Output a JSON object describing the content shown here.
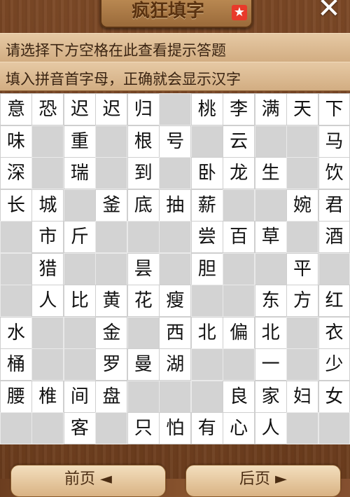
{
  "header": {
    "title": "疯狂填字"
  },
  "hints": {
    "line1": "请选择下方空格在此查看提示答题",
    "line2": "填入拼音首字母，正确就会显示汉字"
  },
  "grid": [
    [
      "意",
      "恐",
      "迟",
      "迟",
      "归",
      "",
      "桃",
      "李",
      "满",
      "天",
      "下"
    ],
    [
      "味",
      "",
      "重",
      "",
      "根",
      "号",
      "",
      "云",
      "",
      "",
      "马"
    ],
    [
      "深",
      "",
      "瑞",
      "",
      "到",
      "",
      "卧",
      "龙",
      "生",
      "",
      "饮"
    ],
    [
      "长",
      "城",
      "",
      "釜",
      "底",
      "抽",
      "薪",
      "",
      "",
      "婉",
      "君"
    ],
    [
      "",
      "市",
      "斤",
      "",
      "",
      "",
      "尝",
      "百",
      "草",
      "",
      "酒"
    ],
    [
      "",
      "猎",
      "",
      "",
      "昙",
      "",
      "胆",
      "",
      "",
      "平",
      ""
    ],
    [
      "",
      "人",
      "比",
      "黄",
      "花",
      "瘦",
      "",
      "",
      "东",
      "方",
      "红"
    ],
    [
      "水",
      "",
      "",
      "金",
      "",
      "西",
      "北",
      "偏",
      "北",
      "",
      "衣"
    ],
    [
      "桶",
      "",
      "",
      "罗",
      "曼",
      "湖",
      "",
      "",
      "一",
      "",
      "少"
    ],
    [
      "腰",
      "椎",
      "间",
      "盘",
      "",
      "",
      "",
      "良",
      "家",
      "妇",
      "女"
    ],
    [
      "",
      "",
      "客",
      "",
      "只",
      "怕",
      "有",
      "心",
      "人",
      "",
      ""
    ]
  ],
  "blanks": [
    [
      0,
      5
    ],
    [
      1,
      1
    ],
    [
      1,
      3
    ],
    [
      1,
      6
    ],
    [
      1,
      8
    ],
    [
      1,
      9
    ],
    [
      2,
      1
    ],
    [
      2,
      3
    ],
    [
      2,
      5
    ],
    [
      2,
      9
    ],
    [
      3,
      2
    ],
    [
      3,
      7
    ],
    [
      3,
      8
    ],
    [
      4,
      0
    ],
    [
      4,
      3
    ],
    [
      4,
      4
    ],
    [
      4,
      5
    ],
    [
      4,
      9
    ],
    [
      5,
      0
    ],
    [
      5,
      2
    ],
    [
      5,
      3
    ],
    [
      5,
      5
    ],
    [
      5,
      7
    ],
    [
      5,
      8
    ],
    [
      5,
      10
    ],
    [
      6,
      0
    ],
    [
      6,
      6
    ],
    [
      6,
      7
    ],
    [
      7,
      1
    ],
    [
      7,
      2
    ],
    [
      7,
      4
    ],
    [
      7,
      9
    ],
    [
      8,
      1
    ],
    [
      8,
      2
    ],
    [
      8,
      6
    ],
    [
      8,
      7
    ],
    [
      8,
      9
    ],
    [
      9,
      4
    ],
    [
      9,
      5
    ],
    [
      9,
      6
    ],
    [
      10,
      0
    ],
    [
      10,
      1
    ],
    [
      10,
      3
    ],
    [
      10,
      9
    ],
    [
      10,
      10
    ]
  ],
  "buttons": {
    "prev_label": "前页  ◄",
    "next_label": "后页  ►"
  }
}
